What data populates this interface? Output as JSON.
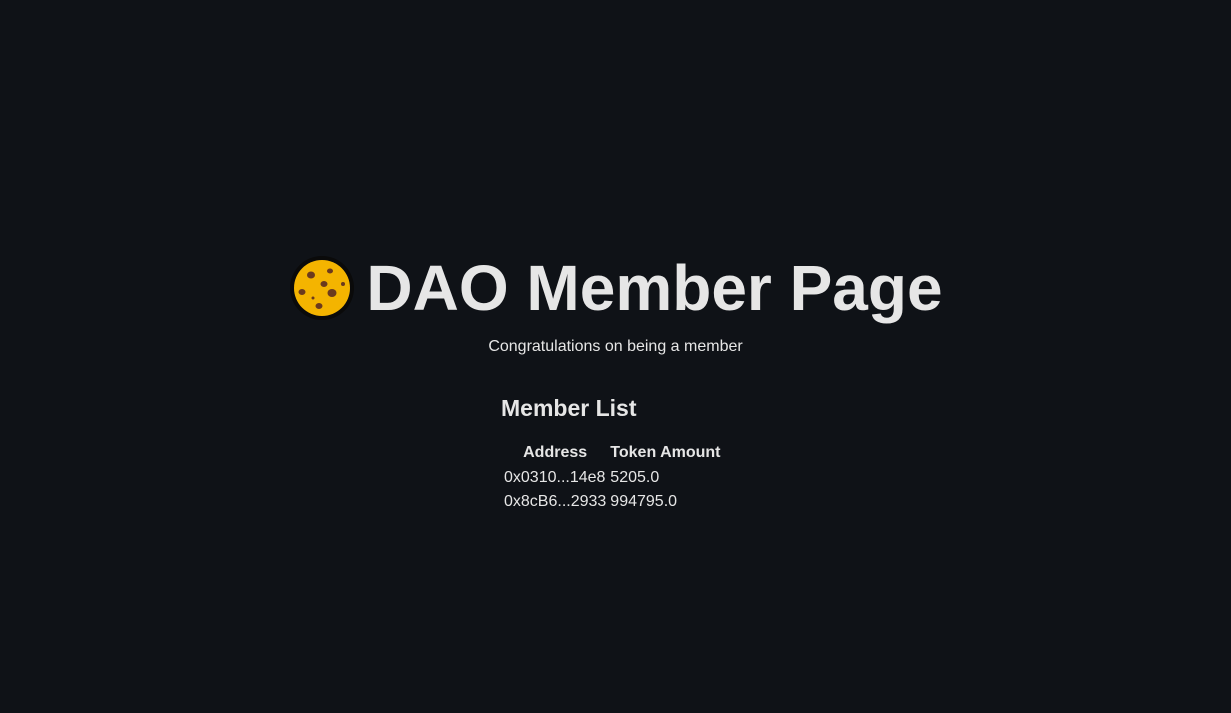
{
  "header": {
    "title": "DAO Member Page",
    "logo_icon": "cookie-icon",
    "subtitle": "Congratulations on being a member"
  },
  "members": {
    "heading": "Member List",
    "columns": [
      "Address",
      "Token Amount"
    ],
    "rows": [
      {
        "address": "0x0310...14e8",
        "amount": "5205.0"
      },
      {
        "address": "0x8cB6...2933",
        "amount": "994795.0"
      }
    ]
  },
  "colors": {
    "background": "#0f1217",
    "text": "#e6e6e6",
    "cookie": "#f4b400",
    "chip": "#6b3a1e"
  }
}
